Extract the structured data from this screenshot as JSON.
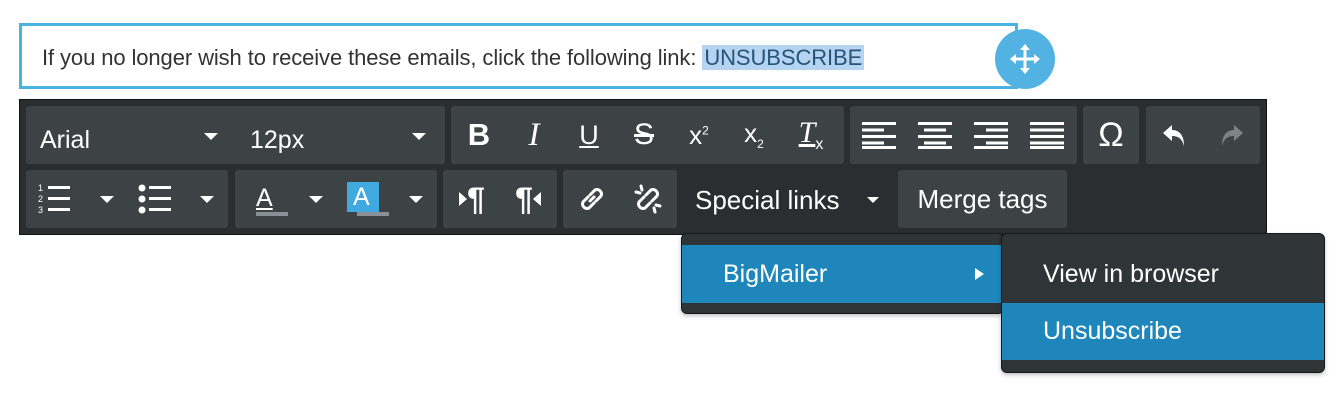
{
  "content": {
    "text": "If you no longer wish to receive these emails, click the following link: ",
    "link": "UNSUBSCRIBE"
  },
  "toolbar": {
    "font_family": "Arial",
    "font_size": "12px",
    "buttons": {
      "bold": "B",
      "italic": "I",
      "underline": "U",
      "strike": "S",
      "superscript": "x",
      "superscript_mark": "2",
      "subscript": "x",
      "subscript_mark": "2",
      "clear_format": "T",
      "clear_mark": "x",
      "special_char": "Ω",
      "text_color": "A",
      "bg_color": "A",
      "ltr": "¶",
      "rtl": "¶"
    },
    "special_links_label": "Special links",
    "merge_tags_label": "Merge tags"
  },
  "menu": {
    "level1": [
      {
        "label": "BigMailer",
        "has_submenu": true
      }
    ],
    "level2": [
      {
        "label": "View in browser"
      },
      {
        "label": "Unsubscribe"
      }
    ]
  },
  "colors": {
    "accent": "#4ab3e3",
    "menu_active": "#1f86bb",
    "toolbar_bg": "#2a2e30",
    "group_bg": "#3d4245"
  },
  "icons": [
    "move-icon",
    "bold-icon",
    "italic-icon",
    "underline-icon",
    "strikethrough-icon",
    "superscript-icon",
    "subscript-icon",
    "clear-format-icon",
    "align-left-icon",
    "align-center-icon",
    "align-right-icon",
    "align-justify-icon",
    "special-char-icon",
    "undo-icon",
    "redo-icon",
    "ordered-list-icon",
    "bullet-list-icon",
    "text-color-icon",
    "background-color-icon",
    "ltr-icon",
    "rtl-icon",
    "link-icon",
    "unlink-icon",
    "chevron-right-icon"
  ]
}
